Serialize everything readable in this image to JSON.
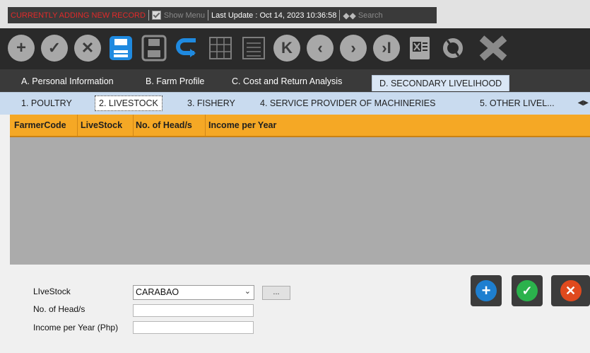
{
  "status": {
    "mode": "CURRENTLY ADDING NEW RECORD",
    "show_menu": "Show Menu",
    "last_update": "Last Update : Oct 14, 2023 10:36:58",
    "search": "Search"
  },
  "toolbar_icons": [
    "add-icon",
    "check-icon",
    "cancel-icon",
    "save-icon",
    "save-as-icon",
    "undo-icon",
    "grid-icon",
    "list-icon",
    "first-icon",
    "previous-icon",
    "next-icon",
    "last-icon",
    "excel-export-icon",
    "refresh-icon",
    "close-icon"
  ],
  "tabs": {
    "main": [
      "A. Personal Information",
      "B. Farm Profile",
      "C. Cost and Return Analysis",
      "D. SECONDARY LIVELIHOOD"
    ],
    "sub": [
      "1. POULTRY",
      "2. LIVESTOCK",
      "3. FISHERY",
      "4. SERVICE PROVIDER OF MACHINERIES",
      "5. OTHER LIVEL..."
    ]
  },
  "grid": {
    "columns": [
      "FarmerCode",
      "LiveStock",
      "No. of Head/s",
      "Income per Year"
    ],
    "rows": []
  },
  "form": {
    "livestock_label": "LIveStock",
    "livestock_value": "CARABAO",
    "browse_label": "...",
    "heads_label": "No. of Head/s",
    "heads_value": "",
    "income_label": "Income per Year (Php)",
    "income_value": ""
  },
  "colors": {
    "grid_header": "#f5a825",
    "mode_text": "#e12a2a",
    "add_button": "#1e7fd0",
    "ok_button": "#2bb24c",
    "cancel_button": "#e04a1e"
  }
}
